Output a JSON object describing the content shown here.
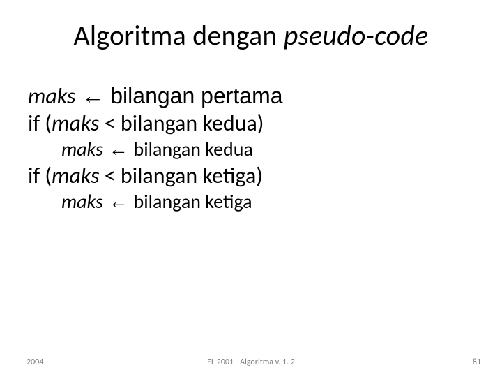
{
  "title": {
    "part1": "Algoritma dengan ",
    "part2_italic": "pseudo-code"
  },
  "lines": {
    "l1_italic": "maks",
    "l1_rest": " ← bilangan pertama",
    "l2_pre": "if (",
    "l2_italic": "maks",
    "l2_rest": " < bilangan kedua)",
    "l3_italic": "maks",
    "l3_arrow": " ← ",
    "l3_rest": "bilangan kedua",
    "l4_pre": "if (",
    "l4_italic": "maks",
    "l4_rest": " < bilangan ketiga)",
    "l5_italic": "maks",
    "l5_arrow": " ← ",
    "l5_rest": "bilangan ketiga"
  },
  "footer": {
    "left": "2004",
    "center": "EL 2001 - Algoritma v. 1. 2",
    "right": "81"
  }
}
